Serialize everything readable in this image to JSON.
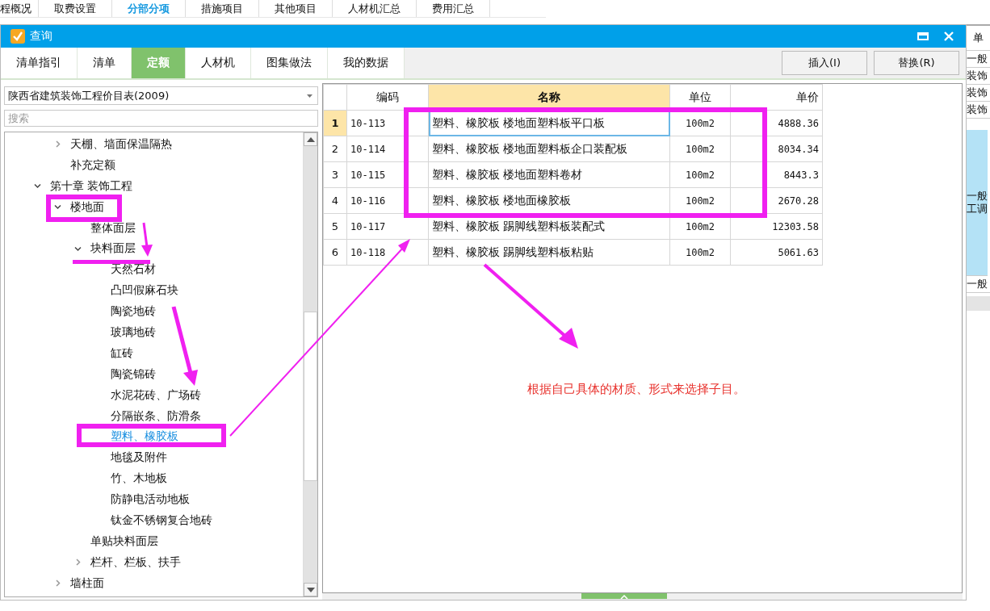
{
  "menu_bar": {
    "items": [
      {
        "label": "程概况",
        "selected": false
      },
      {
        "label": "取费设置",
        "selected": false
      },
      {
        "label": "分部分项",
        "selected": true
      },
      {
        "label": "措施项目",
        "selected": false
      },
      {
        "label": "其他项目",
        "selected": false
      },
      {
        "label": "人材机汇总",
        "selected": false
      },
      {
        "label": "费用汇总",
        "selected": false
      }
    ]
  },
  "dialog": {
    "title": "查询",
    "tabs": [
      {
        "label": "清单指引",
        "selected": false
      },
      {
        "label": "清单",
        "selected": false
      },
      {
        "label": "定额",
        "selected": true
      },
      {
        "label": "人材机",
        "selected": false
      },
      {
        "label": "图集做法",
        "selected": false
      },
      {
        "label": "我的数据",
        "selected": false
      }
    ],
    "buttons": [
      "插入(I)",
      "替换(R)"
    ],
    "library_dropdown": {
      "value": "陕西省建筑装饰工程价目表(2009)"
    },
    "search": {
      "placeholder": "搜索"
    },
    "tree": {
      "partial_branch": [
        {
          "label": "天棚、墙面保温隔热",
          "kind": "folder",
          "expanded": false,
          "selected": false
        },
        {
          "label": "补充定额",
          "kind": "leaf",
          "selected": false
        }
      ],
      "items": [
        {
          "label": "第十章 装饰工程",
          "kind": "folder",
          "expanded": true,
          "selected": false,
          "children": [
            {
              "label": "楼地面",
              "kind": "folder",
              "expanded": true,
              "selected": false,
              "children": [
                {
                  "label": "整体面层",
                  "kind": "leaf",
                  "selected": false
                },
                {
                  "label": "块料面层",
                  "kind": "folder",
                  "expanded": true,
                  "selected": false,
                  "children": [
                    {
                      "label": "天然石材",
                      "kind": "leaf",
                      "selected": false
                    },
                    {
                      "label": "凸凹假麻石块",
                      "kind": "leaf",
                      "selected": false
                    },
                    {
                      "label": "陶瓷地砖",
                      "kind": "leaf",
                      "selected": false
                    },
                    {
                      "label": "玻璃地砖",
                      "kind": "leaf",
                      "selected": false
                    },
                    {
                      "label": "缸砖",
                      "kind": "leaf",
                      "selected": false
                    },
                    {
                      "label": "陶瓷锦砖",
                      "kind": "leaf",
                      "selected": false
                    },
                    {
                      "label": "水泥花砖、广场砖",
                      "kind": "leaf",
                      "selected": false
                    },
                    {
                      "label": "分隔嵌条、防滑条",
                      "kind": "leaf",
                      "selected": false
                    },
                    {
                      "label": "塑料、橡胶板",
                      "kind": "leaf",
                      "selected": true
                    },
                    {
                      "label": "地毯及附件",
                      "kind": "leaf",
                      "selected": false
                    },
                    {
                      "label": "竹、木地板",
                      "kind": "leaf",
                      "selected": false
                    },
                    {
                      "label": "防静电活动地板",
                      "kind": "leaf",
                      "selected": false
                    },
                    {
                      "label": "钛金不锈钢复合地砖",
                      "kind": "leaf",
                      "selected": false
                    }
                  ]
                },
                {
                  "label": "单贴块料面层",
                  "kind": "leaf",
                  "selected": false
                },
                {
                  "label": "栏杆、栏板、扶手",
                  "kind": "folder",
                  "expanded": false,
                  "selected": false
                }
              ]
            },
            {
              "label": "墙柱面",
              "kind": "folder",
              "expanded": false,
              "selected": false
            }
          ]
        }
      ]
    },
    "table": {
      "columns": [
        {
          "label": "编码",
          "selected": false
        },
        {
          "label": "名称",
          "selected": true
        },
        {
          "label": "单位",
          "selected": false
        },
        {
          "label": "单价",
          "selected": false
        }
      ],
      "rows": [
        {
          "number": "1",
          "code": "10-113",
          "name": "塑料、橡胶板 楼地面塑料板平口板",
          "unit": "100m2",
          "price": "4888.36",
          "selected": true
        },
        {
          "number": "2",
          "code": "10-114",
          "name": "塑料、橡胶板 楼地面塑料板企口装配板",
          "unit": "100m2",
          "price": "8034.34",
          "selected": false
        },
        {
          "number": "3",
          "code": "10-115",
          "name": "塑料、橡胶板 楼地面塑料卷材",
          "unit": "100m2",
          "price": "8443.3",
          "selected": false
        },
        {
          "number": "4",
          "code": "10-116",
          "name": "塑料、橡胶板 楼地面橡胶板",
          "unit": "100m2",
          "price": "2670.28",
          "selected": false
        },
        {
          "number": "5",
          "code": "10-117",
          "name": "塑料、橡胶板 踢脚线塑料板装配式",
          "unit": "100m2",
          "price": "12303.58",
          "selected": false
        },
        {
          "number": "6",
          "code": "10-118",
          "name": "塑料、橡胶板 踢脚线塑料板粘贴",
          "unit": "100m2",
          "price": "5061.63",
          "selected": false
        }
      ]
    },
    "note": "根据自己具体的材质、形式来选择子目。"
  },
  "side_panel": {
    "header": "单",
    "rows": [
      {
        "text": "一般",
        "selected": false
      },
      {
        "text": "装饰",
        "selected": false
      },
      {
        "text": "装饰",
        "selected": false
      },
      {
        "text": "装饰",
        "selected": false
      },
      {
        "text": "一般工调",
        "selected": true
      },
      {
        "text": "一般",
        "selected": false
      }
    ]
  }
}
